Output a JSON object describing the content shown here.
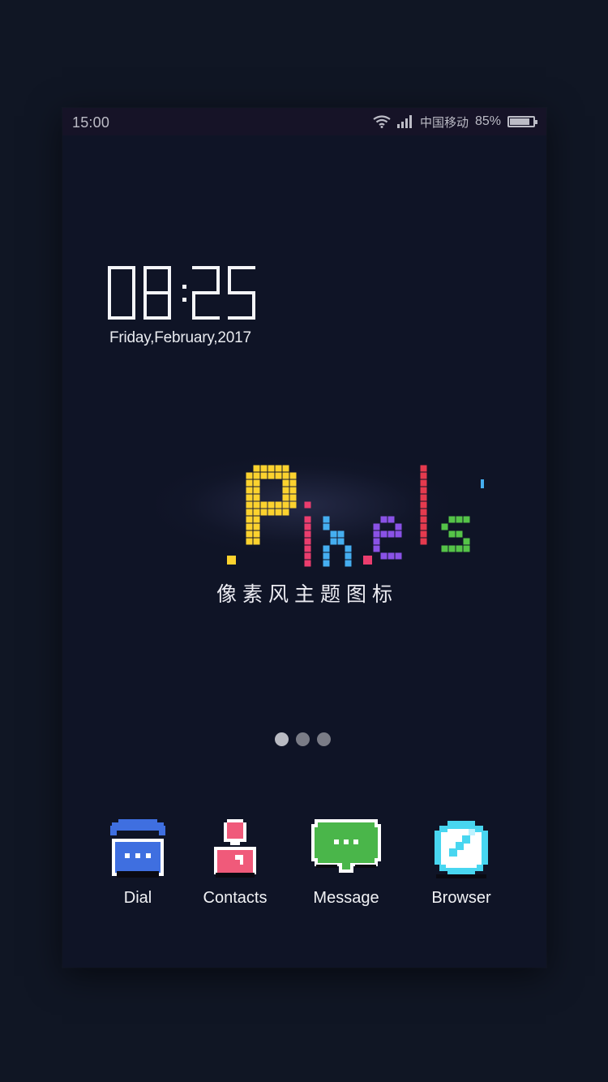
{
  "status_bar": {
    "time": "15:00",
    "carrier": "中国移动",
    "battery_percent": "85%",
    "battery_level": 0.85,
    "icons": [
      "wifi-icon",
      "signal-icon",
      "battery-icon"
    ]
  },
  "clock": {
    "time": "08:25",
    "date": "Friday,February,2017"
  },
  "theme": {
    "logo_text": "Pixels",
    "subtitle": "像素风主题图标",
    "letter_colors": [
      "#fcd22e",
      "#eb3d6e",
      "#45aef0",
      "#8a52e6",
      "#e53a4e",
      "#55c348"
    ]
  },
  "page_indicator": {
    "count": 3,
    "active_index": 0
  },
  "dock": {
    "items": [
      {
        "label": "Dial",
        "icon": "phone-icon"
      },
      {
        "label": "Contacts",
        "icon": "contacts-icon"
      },
      {
        "label": "Message",
        "icon": "message-icon"
      },
      {
        "label": "Browser",
        "icon": "browser-icon"
      }
    ]
  },
  "colors": {
    "background": "#101624",
    "screen": "#0f1426",
    "dial": "#3f6fe0",
    "contacts": "#f05a7a",
    "message": "#4ab64a",
    "browser": "#48d6f0"
  }
}
